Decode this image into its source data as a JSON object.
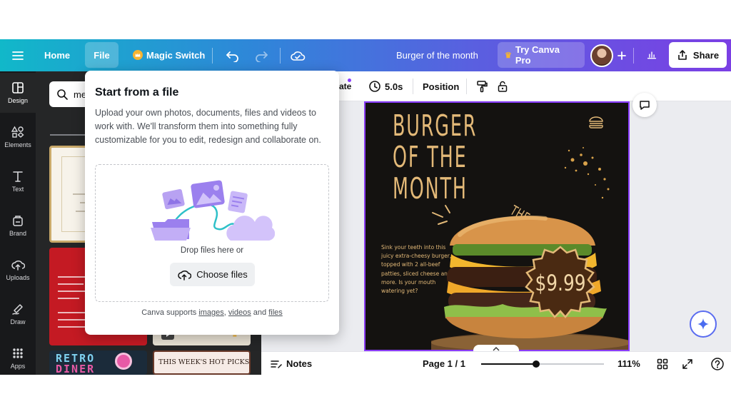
{
  "topbar": {
    "home": "Home",
    "file": "File",
    "magic_switch": "Magic Switch",
    "doc_title": "Burger of the month",
    "try_pro": "Try Canva Pro",
    "share": "Share"
  },
  "rail": {
    "items": [
      {
        "label": "Design",
        "icon": "design-icon"
      },
      {
        "label": "Elements",
        "icon": "elements-icon"
      },
      {
        "label": "Text",
        "icon": "text-icon"
      },
      {
        "label": "Brand",
        "icon": "brand-icon"
      },
      {
        "label": "Uploads",
        "icon": "uploads-icon"
      },
      {
        "label": "Draw",
        "icon": "draw-icon"
      },
      {
        "label": "Apps",
        "icon": "apps-icon"
      }
    ]
  },
  "panel": {
    "search_value": "me",
    "thumb_retro_line1": "RETRO",
    "thumb_retro_line2": "DINER",
    "thumb_weeks": "THIS WEEK'S HOT PICKS"
  },
  "ctx": {
    "animate_partial": "ate",
    "duration": "5.0s",
    "position": "Position"
  },
  "design": {
    "headline_1": "BURGER",
    "headline_2": "OF THE",
    "headline_3": "MONTH",
    "tagline": "THE BIG CHEESY",
    "body": "Sink your teeth into this juicy extra-cheesy burger, topped with 2 all-beef patties, sliced cheese and more. Is your mouth watering yet?",
    "price": "$9.99"
  },
  "bottombar": {
    "notes": "Notes",
    "page": "Page 1 / 1",
    "zoom": "111%",
    "zoom_fraction": 0.45
  },
  "popup": {
    "title": "Start from a file",
    "description": "Upload your own photos, documents, files and videos to work with. We'll transform them into something fully customizable for you to edit, redesign and collaborate on.",
    "drop_text": "Drop files here or",
    "choose_files": "Choose files",
    "support_prefix": "Canva supports",
    "support_images": "images",
    "support_sep": ",",
    "support_videos": "videos",
    "support_and": "and",
    "support_files": "files"
  },
  "colors": {
    "accent": "#8b3dff",
    "topbar_start": "#11b8c9",
    "topbar_end": "#7b3fe4",
    "design_bg": "#141210",
    "headline": "#e3b978",
    "price_bg": "#4a2a12"
  }
}
